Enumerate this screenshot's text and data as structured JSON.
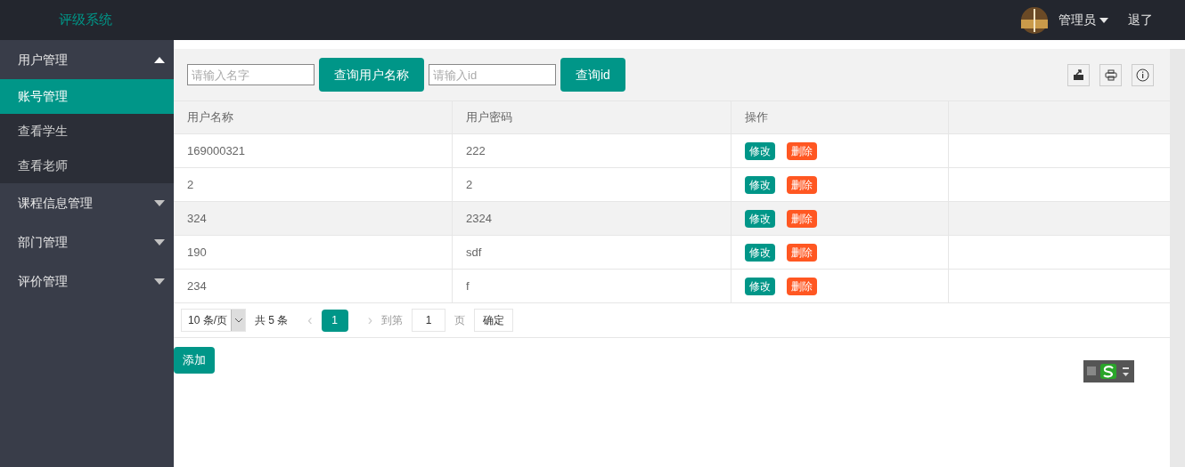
{
  "header": {
    "logo": "评级系统",
    "user": "管理员",
    "logout": "退了"
  },
  "sidebar": {
    "items": [
      {
        "label": "用户管理",
        "expanded": true,
        "children": [
          {
            "label": "账号管理",
            "selected": true
          },
          {
            "label": "查看学生",
            "selected": false
          },
          {
            "label": "查看老师",
            "selected": false
          }
        ]
      },
      {
        "label": "课程信息管理",
        "expanded": false
      },
      {
        "label": "部门管理",
        "expanded": false
      },
      {
        "label": "评价管理",
        "expanded": false
      }
    ]
  },
  "toolbar": {
    "name_field": {
      "placeholder": "请输入名字"
    },
    "name_button": "查询用户名称",
    "id_field": {
      "placeholder": "请输入id"
    },
    "id_button": "查询id"
  },
  "table": {
    "columns": [
      "用户名称",
      "用户密码",
      "操作"
    ],
    "rows": [
      {
        "name": "169000321",
        "password": "222",
        "edit": "修改",
        "delete": "删除",
        "highlighted": false
      },
      {
        "name": "2",
        "password": "2",
        "edit": "修改",
        "delete": "删除",
        "highlighted": false
      },
      {
        "name": "324",
        "password": "2324",
        "edit": "修改",
        "delete": "删除",
        "highlighted": true
      },
      {
        "name": "190",
        "password": "sdf",
        "edit": "修改",
        "delete": "删除",
        "highlighted": false
      },
      {
        "name": "234",
        "password": "f",
        "edit": "修改",
        "delete": "删除",
        "highlighted": false
      }
    ]
  },
  "pagination": {
    "page_size": "10 条/页",
    "total": "共 5 条",
    "prev": "‹",
    "pages": [
      {
        "label": "1",
        "selected": true
      }
    ],
    "next": "›",
    "goto_label": "到第",
    "goto_value": "1",
    "page_label": "页",
    "confirm": "确定"
  },
  "add_button": "添加"
}
